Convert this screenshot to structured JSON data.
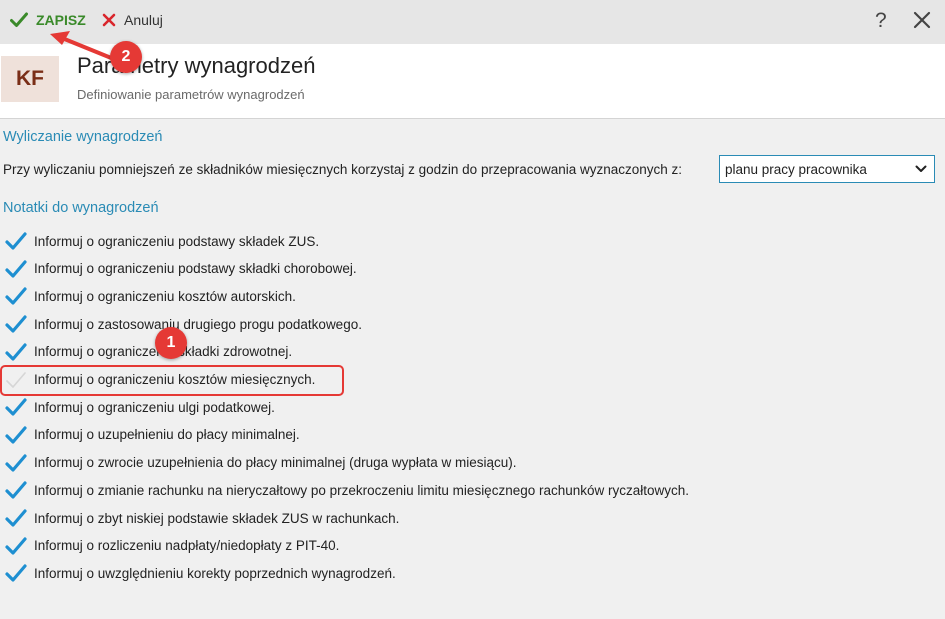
{
  "toolbar": {
    "save_label": "ZAPISZ",
    "cancel_label": "Anuluj",
    "help_label": "?",
    "save_icon": "check-icon",
    "cancel_icon": "x-icon",
    "close_icon": "close-icon"
  },
  "header": {
    "avatar_text": "KF",
    "title": "Parametry wynagrodzeń",
    "subtitle": "Definiowanie parametrów wynagrodzeń"
  },
  "calculation": {
    "section_title": "Wyliczanie wynagrodzeń",
    "label": "Przy wyliczaniu pomniejszeń ze składników miesięcznych korzystaj z godzin do przepracowania wyznaczonych z:",
    "select_value": "planu pracy pracownika"
  },
  "notes": {
    "section_title": "Notatki do wynagrodzeń",
    "items": [
      {
        "label": "Informuj o ograniczeniu podstawy składek ZUS.",
        "checked": true
      },
      {
        "label": "Informuj o ograniczeniu podstawy składki chorobowej.",
        "checked": true
      },
      {
        "label": "Informuj o ograniczeniu kosztów autorskich.",
        "checked": true
      },
      {
        "label": "Informuj o zastosowaniu drugiego progu podatkowego.",
        "checked": true
      },
      {
        "label": "Informuj o ograniczeniu składki zdrowotnej.",
        "checked": true
      },
      {
        "label": "Informuj o ograniczeniu kosztów miesięcznych.",
        "checked": false
      },
      {
        "label": "Informuj o ograniczeniu ulgi podatkowej.",
        "checked": true
      },
      {
        "label": "Informuj o uzupełnieniu do płacy minimalnej.",
        "checked": true
      },
      {
        "label": "Informuj o zwrocie uzupełnienia do płacy minimalnej (druga wypłata w miesiącu).",
        "checked": true
      },
      {
        "label": "Informuj o zmianie rachunku na nieryczałtowy po przekroczeniu limitu miesięcznego rachunków ryczałtowych.",
        "checked": true
      },
      {
        "label": "Informuj o zbyt niskiej podstawie składek ZUS w rachunkach.",
        "checked": true
      },
      {
        "label": "Informuj o rozliczeniu nadpłaty/niedopłaty z PIT-40.",
        "checked": true
      },
      {
        "label": "Informuj o uwzględnieniu korekty poprzednich wynagrodzeń.",
        "checked": true
      }
    ]
  },
  "annotations": {
    "badge_1": "1",
    "badge_2": "2"
  },
  "colors": {
    "accent_blue": "#2a8bb5",
    "check_blue": "#1e8fd1",
    "save_green": "#3a8a2a",
    "cancel_red": "#d9262c",
    "annotation_red": "#e53935",
    "avatar_bg": "#efe1da",
    "avatar_text": "#7a2e17"
  }
}
